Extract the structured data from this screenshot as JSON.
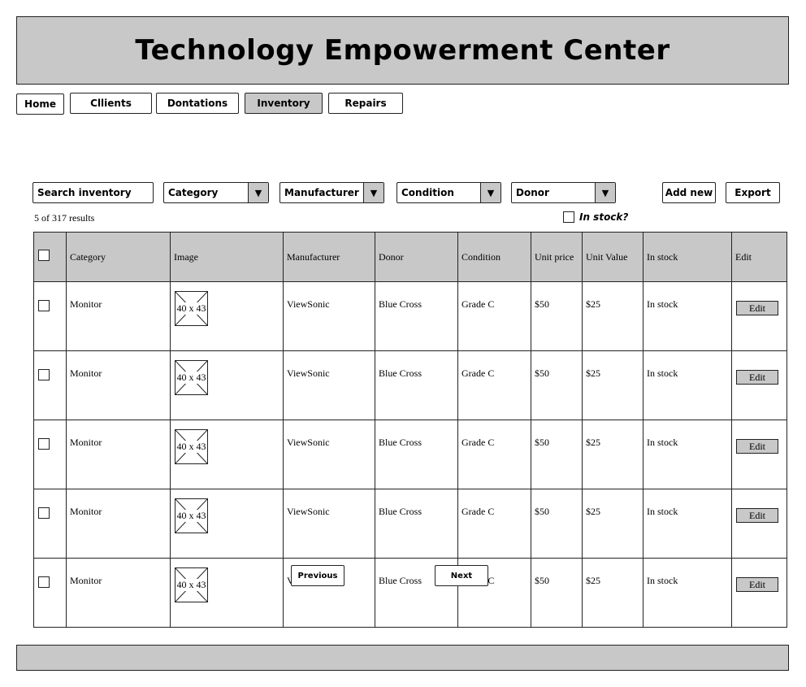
{
  "app": {
    "title": "Technology Empowerment Center"
  },
  "nav": {
    "tabs": [
      {
        "label": "Home",
        "active": false
      },
      {
        "label": "Cllients",
        "active": false
      },
      {
        "label": "Dontations",
        "active": false
      },
      {
        "label": "Inventory",
        "active": true
      },
      {
        "label": "Repairs",
        "active": false
      }
    ]
  },
  "filters": {
    "search_placeholder": "Search inventory",
    "category": "Category",
    "manufacturer": "Manufacturer",
    "condition": "Condition",
    "donor": "Donor",
    "dropdown_icon": "triangle-down-icon",
    "in_stock_label": "In stock?",
    "in_stock_checked": false
  },
  "actions": {
    "add_new": "Add new",
    "export": "Export"
  },
  "results": {
    "count_text": "5 of 317 results"
  },
  "table": {
    "headers": [
      "Category",
      "Image",
      "Manufacturer",
      "Donor",
      "Condition",
      "Unit price",
      "Unit Value",
      "In stock",
      "Edit"
    ],
    "rows": [
      {
        "category": "Monitor",
        "image": "40 x 43",
        "manufacturer": "ViewSonic",
        "donor": "Blue Cross",
        "condition": "Grade C",
        "unit_price": "$50",
        "unit_value": "$25",
        "in_stock": "In stock",
        "edit": "Edit"
      },
      {
        "category": "Monitor",
        "image": "40 x 43",
        "manufacturer": "ViewSonic",
        "donor": "Blue Cross",
        "condition": "Grade C",
        "unit_price": "$50",
        "unit_value": "$25",
        "in_stock": "In stock",
        "edit": "Edit"
      },
      {
        "category": "Monitor",
        "image": "40 x 43",
        "manufacturer": "ViewSonic",
        "donor": "Blue Cross",
        "condition": "Grade C",
        "unit_price": "$50",
        "unit_value": "$25",
        "in_stock": "In stock",
        "edit": "Edit"
      },
      {
        "category": "Monitor",
        "image": "40 x 43",
        "manufacturer": "ViewSonic",
        "donor": "Blue Cross",
        "condition": "Grade C",
        "unit_price": "$50",
        "unit_value": "$25",
        "in_stock": "In stock",
        "edit": "Edit"
      },
      {
        "category": "Monitor",
        "image": "40 x 43",
        "manufacturer": "ViewSonic",
        "donor": "Blue Cross",
        "condition": "Grade C",
        "unit_price": "$50",
        "unit_value": "$25",
        "in_stock": "In stock",
        "edit": "Edit"
      }
    ]
  },
  "pagination": {
    "previous": "Previous",
    "next": "Next"
  },
  "colors": {
    "header_bg": "#c8c8c8",
    "active_tab_bg": "#c8c8c8",
    "border": "#222222"
  }
}
